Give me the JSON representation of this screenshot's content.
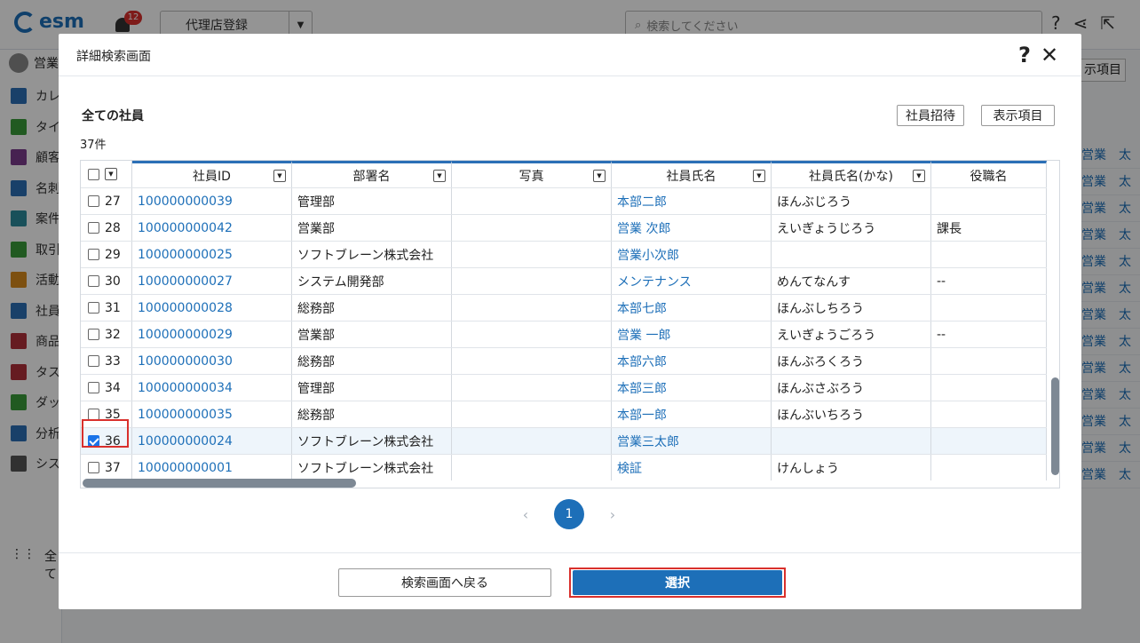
{
  "app": {
    "logo": "esm",
    "notification_count": "12",
    "agency_select": "代理店登録",
    "search_placeholder": "検索してください",
    "sidebar": {
      "user": "営業",
      "items": [
        "カレ",
        "タイ",
        "顧客",
        "名刺",
        "案件",
        "取引",
        "活動",
        "社員",
        "商品",
        "タス",
        "ダッ",
        "分析",
        "シス"
      ],
      "all": "全て"
    },
    "right_button": "示項目",
    "right_rows": [
      "営業　太",
      "営業　太",
      "営業　太",
      "営業　太",
      "営業　太",
      "営業　太",
      "営業　太",
      "営業　太",
      "営業　太",
      "営業　太",
      "営業　太",
      "営業　太",
      "営業　太"
    ]
  },
  "modal": {
    "title": "詳細検索画面",
    "help": "?",
    "close": "✕",
    "section_title": "全ての社員",
    "count": "37件",
    "invite_button": "社員招待",
    "display_items_button": "表示項目",
    "columns": [
      "社員ID",
      "部署名",
      "写真",
      "社員氏名",
      "社員氏名(かな)",
      "役職名"
    ],
    "rows": [
      {
        "no": "27",
        "id": "100000000039",
        "dept": "管理部",
        "photo": "",
        "name": "本部二郎",
        "kana": "ほんぶじろう",
        "title": "",
        "checked": false
      },
      {
        "no": "28",
        "id": "100000000042",
        "dept": "営業部",
        "photo": "",
        "name": "営業 次郎",
        "kana": "えいぎょうじろう",
        "title": "課長",
        "checked": false
      },
      {
        "no": "29",
        "id": "100000000025",
        "dept": "ソフトブレーン株式会社",
        "photo": "",
        "name": "営業小次郎",
        "kana": "",
        "title": "",
        "checked": false
      },
      {
        "no": "30",
        "id": "100000000027",
        "dept": "システム開発部",
        "photo": "",
        "name": "メンテナンス",
        "kana": "めんてなんす",
        "title": "--",
        "checked": false
      },
      {
        "no": "31",
        "id": "100000000028",
        "dept": "総務部",
        "photo": "",
        "name": "本部七郎",
        "kana": "ほんぶしちろう",
        "title": "",
        "checked": false
      },
      {
        "no": "32",
        "id": "100000000029",
        "dept": "営業部",
        "photo": "",
        "name": "営業 一郎",
        "kana": "えいぎょうごろう",
        "title": "--",
        "checked": false
      },
      {
        "no": "33",
        "id": "100000000030",
        "dept": "総務部",
        "photo": "",
        "name": "本部六郎",
        "kana": "ほんぶろくろう",
        "title": "",
        "checked": false
      },
      {
        "no": "34",
        "id": "100000000034",
        "dept": "管理部",
        "photo": "",
        "name": "本部三郎",
        "kana": "ほんぶさぶろう",
        "title": "",
        "checked": false
      },
      {
        "no": "35",
        "id": "100000000035",
        "dept": "総務部",
        "photo": "",
        "name": "本部一郎",
        "kana": "ほんぶいちろう",
        "title": "",
        "checked": false
      },
      {
        "no": "36",
        "id": "100000000024",
        "dept": "ソフトブレーン株式会社",
        "photo": "",
        "name": "営業三太郎",
        "kana": "",
        "title": "",
        "checked": true
      },
      {
        "no": "37",
        "id": "100000000001",
        "dept": "ソフトブレーン株式会社",
        "photo": "",
        "name": "検証",
        "kana": "けんしょう",
        "title": "",
        "checked": false
      }
    ],
    "page": "1",
    "back_button": "検索画面へ戻る",
    "select_button": "選択"
  }
}
